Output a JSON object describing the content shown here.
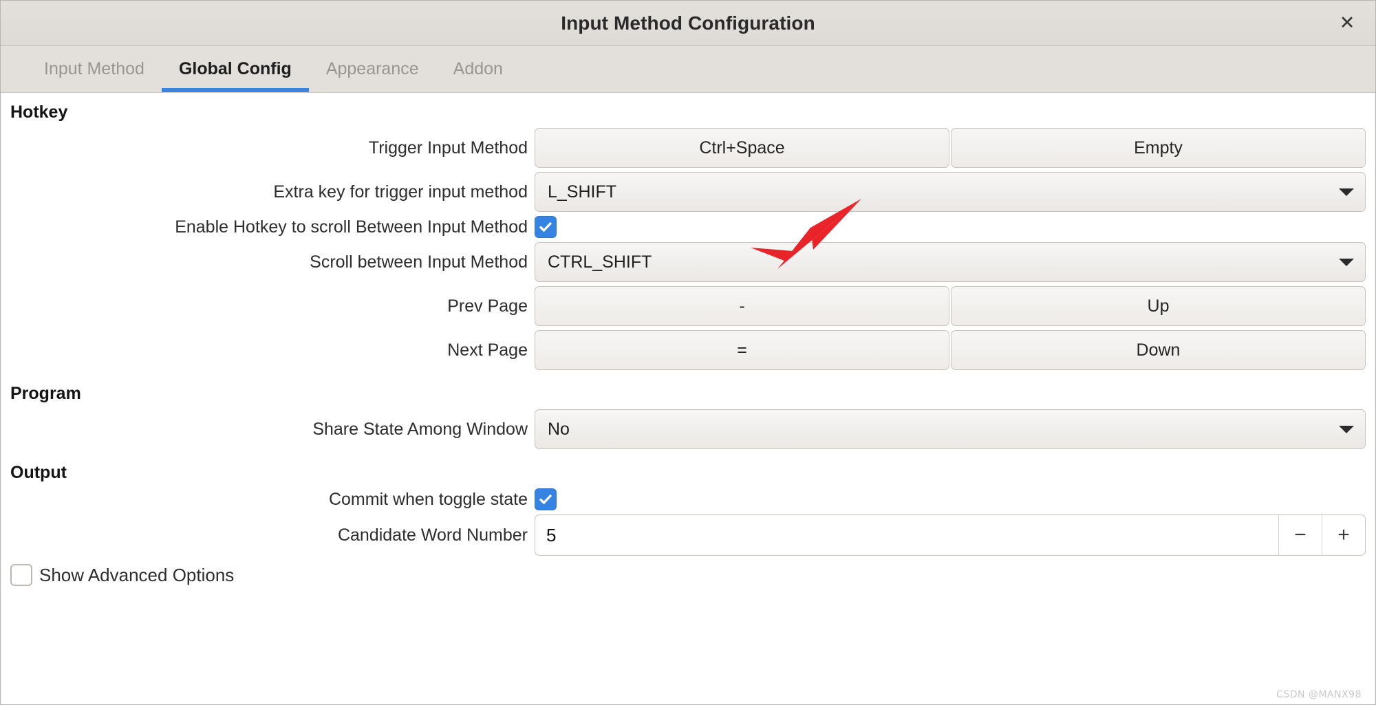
{
  "window": {
    "title": "Input Method Configuration",
    "close_icon": "close-icon",
    "close_label": "✕"
  },
  "tabs": [
    {
      "label": "Input Method",
      "active": false
    },
    {
      "label": "Global Config",
      "active": true
    },
    {
      "label": "Appearance",
      "active": false
    },
    {
      "label": "Addon",
      "active": false
    }
  ],
  "sections": {
    "hotkey": {
      "heading": "Hotkey",
      "trigger_input_method": {
        "label": "Trigger Input Method",
        "primary": "Ctrl+Space",
        "secondary": "Empty"
      },
      "extra_key": {
        "label": "Extra key for trigger input method",
        "value": "L_SHIFT"
      },
      "enable_scroll_hotkey": {
        "label": "Enable Hotkey to scroll Between Input Method",
        "checked": true
      },
      "scroll_between": {
        "label": "Scroll between Input Method",
        "value": "CTRL_SHIFT"
      },
      "prev_page": {
        "label": "Prev Page",
        "primary": "-",
        "secondary": "Up"
      },
      "next_page": {
        "label": "Next Page",
        "primary": "=",
        "secondary": "Down"
      }
    },
    "program": {
      "heading": "Program",
      "share_state": {
        "label": "Share State Among Window",
        "value": "No"
      }
    },
    "output": {
      "heading": "Output",
      "commit_toggle": {
        "label": "Commit when toggle state",
        "checked": true
      },
      "candidate_word_number": {
        "label": "Candidate Word Number",
        "value": "5",
        "decrement_label": "−",
        "increment_label": "+"
      }
    }
  },
  "advanced_options": {
    "label": "Show Advanced Options",
    "checked": false
  },
  "annotation": {
    "type": "red-arrow",
    "points_to": "Ctrl+Space",
    "color": "#e8232a"
  },
  "watermark": "CSDN @MANX98",
  "colors": {
    "accent": "#3584e4",
    "titlebar": "#e1ddd8",
    "tabbar": "#e3dfdb",
    "content": "#ffffff",
    "annotation_red": "#e8232a"
  }
}
